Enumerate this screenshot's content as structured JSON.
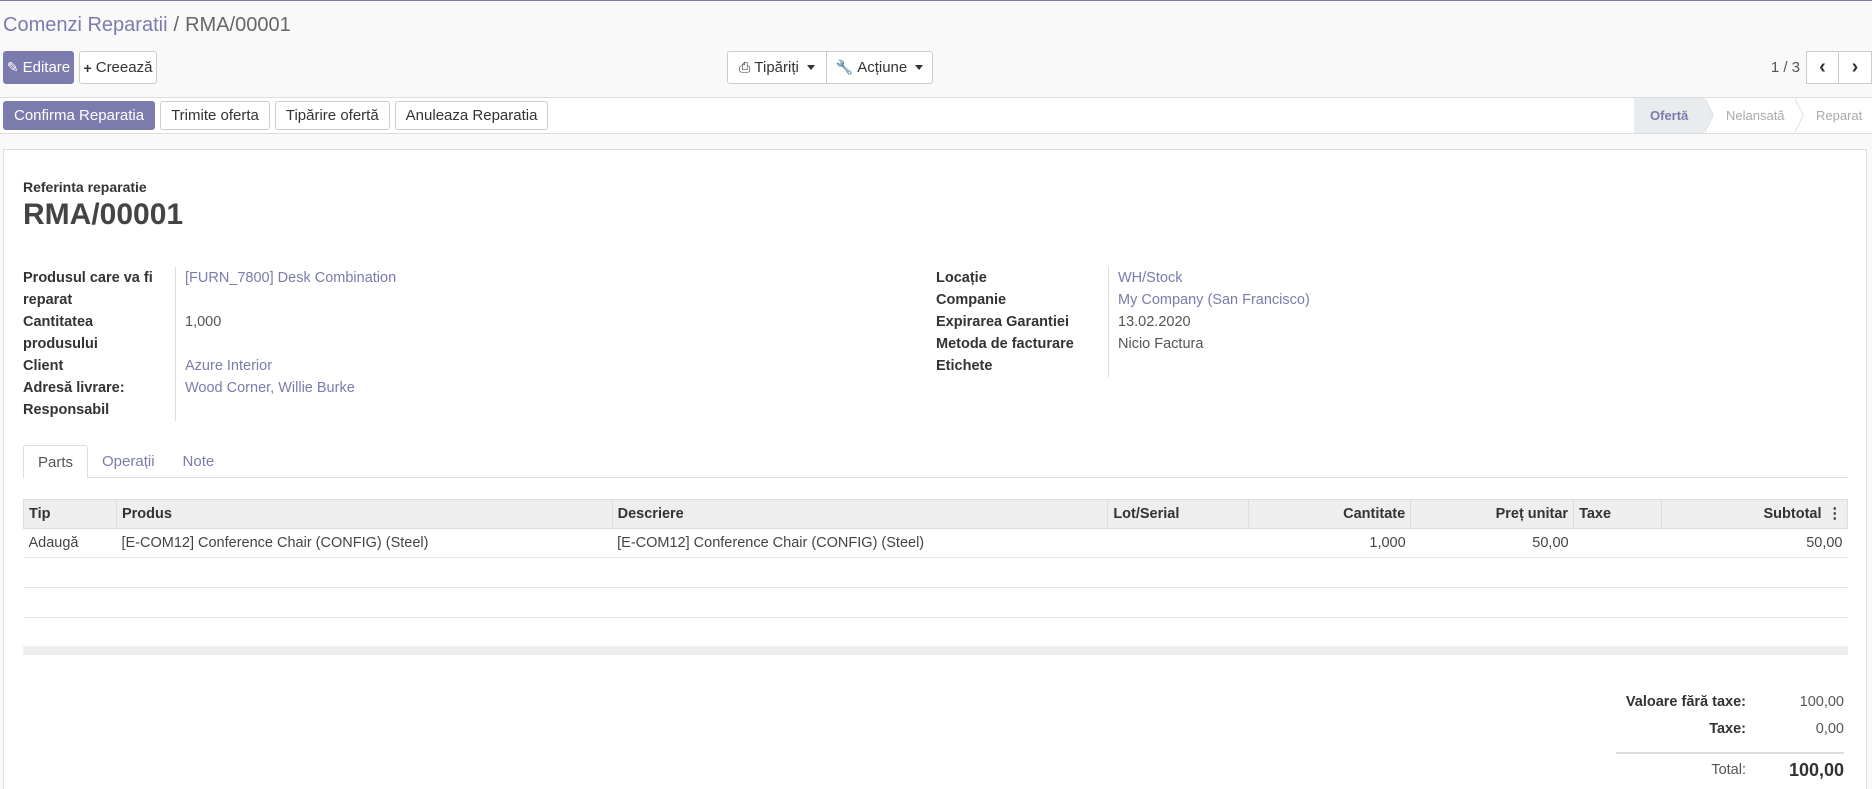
{
  "breadcrumb": {
    "parent": "Comenzi Reparatii",
    "separator": "/",
    "current": "RMA/00001"
  },
  "control_panel": {
    "edit_label": "Editare",
    "create_label": "Creează",
    "print_label": "Tipăriți",
    "action_label": "Acțiune",
    "pager_value": "1 / 3",
    "prev_icon": "‹",
    "next_icon": "›"
  },
  "statusbar": {
    "buttons": [
      "Confirma Reparatia",
      "Trimite oferta",
      "Tipărire ofertă",
      "Anuleaza Reparatia"
    ],
    "steps": [
      {
        "label": "Ofertă",
        "active": true
      },
      {
        "label": "Nelansată",
        "active": false
      },
      {
        "label": "Reparat",
        "active": false
      }
    ]
  },
  "form": {
    "ref_label": "Referinta reparatie",
    "ref_value": "RMA/00001",
    "left": [
      {
        "label": "Produsul care va fi reparat",
        "value": "[FURN_7800] Desk Combination",
        "link": true
      },
      {
        "label": "Cantitatea produsului",
        "value": "1,000",
        "link": false
      },
      {
        "label": "Client",
        "value": "Azure Interior",
        "link": true
      },
      {
        "label": "Adresă livrare:",
        "value": "Wood Corner, Willie Burke",
        "link": true
      },
      {
        "label": "Responsabil",
        "value": "",
        "link": false
      }
    ],
    "right": [
      {
        "label": "Locație",
        "value": "WH/Stock",
        "link": true
      },
      {
        "label": "Companie",
        "value": "My Company (San Francisco)",
        "link": true
      },
      {
        "label": "Expirarea Garantiei",
        "value": "13.02.2020",
        "link": false
      },
      {
        "label": "Metoda de facturare",
        "value": "Nicio Factura",
        "link": false
      },
      {
        "label": "Etichete",
        "value": "",
        "link": false
      }
    ]
  },
  "tabs": [
    {
      "label": "Parts",
      "active": true
    },
    {
      "label": "Operații",
      "active": false
    },
    {
      "label": "Note",
      "active": false
    }
  ],
  "table": {
    "headers": [
      "Tip",
      "Produs",
      "Descriere",
      "Lot/Serial",
      "Cantitate",
      "Preț unitar",
      "Taxe",
      "Subtotal"
    ],
    "rows": [
      [
        "Adaugă",
        "[E-COM12] Conference Chair (CONFIG) (Steel)",
        "[E-COM12] Conference Chair (CONFIG) (Steel)",
        "",
        "1,000",
        "50,00",
        "",
        "50,00"
      ]
    ]
  },
  "totals": {
    "untaxed_label": "Valoare fără taxe:",
    "untaxed_value": "100,00",
    "tax_label": "Taxe:",
    "tax_value": "0,00",
    "total_label": "Total:",
    "total_value": "100,00"
  },
  "colors": {
    "primary": "#7c7bad",
    "link": "#7c7bad",
    "header_bg": "#eeeeee"
  }
}
